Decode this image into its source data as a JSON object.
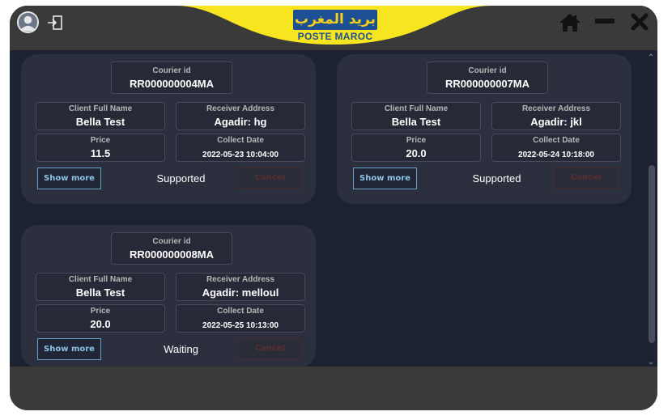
{
  "logo": {
    "arabic": "بريد المغرب",
    "text": "POSTE MAROC"
  },
  "colors": {
    "accent_yellow": "#f7d117",
    "brand_blue": "#1d4f95",
    "background": "#1c2230",
    "card": "#2b2f3e"
  },
  "labels": {
    "courier_id": "Courier id",
    "client_name": "Client Full Name",
    "receiver_address": "Receiver Address",
    "price": "Price",
    "collect_date": "Collect Date",
    "show_more": "Show more",
    "cancel": "Cancel"
  },
  "cards": [
    {
      "courier_id": "RR000000004MA",
      "client_name": "Bella Test",
      "receiver_address": "Agadir: hg",
      "price": "11.5",
      "collect_date": "2022-05-23 10:04:00",
      "status": "Supported"
    },
    {
      "courier_id": "RR000000007MA",
      "client_name": "Bella Test",
      "receiver_address": "Agadir: jkl",
      "price": "20.0",
      "collect_date": "2022-05-24 10:18:00",
      "status": "Supported"
    },
    {
      "courier_id": "RR000000008MA",
      "client_name": "Bella Test",
      "receiver_address": "Agadir: melloul",
      "price": "20.0",
      "collect_date": "2022-05-25 10:13:00",
      "status": "Waiting"
    }
  ]
}
